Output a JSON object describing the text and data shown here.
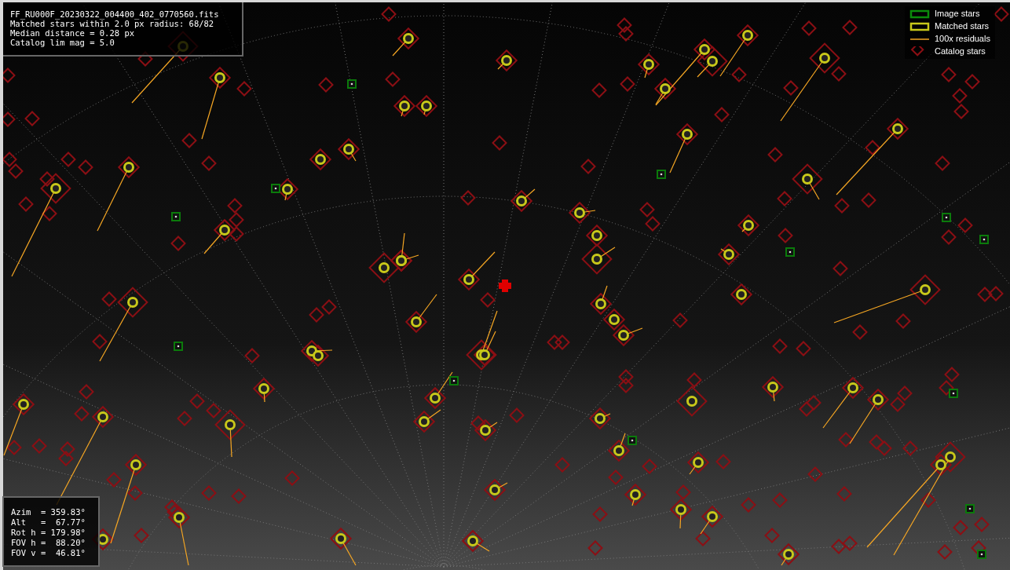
{
  "info_box": {
    "lines": [
      "FF_RU000F_20230322_004400_402_0770560.fits",
      "Matched stars within 2.0 px radius: 68/82",
      "Median distance = 0.28 px",
      "Catalog lim mag = 5.0"
    ]
  },
  "legend": [
    {
      "kind": "image",
      "label": "Image stars"
    },
    {
      "kind": "matched",
      "label": "Matched stars"
    },
    {
      "kind": "residual",
      "label": "100x residuals"
    },
    {
      "kind": "catalog",
      "label": "Catalog stars"
    }
  ],
  "pointing_box": {
    "lines": [
      "Azim  = 359.83°",
      "Alt   =  67.77°",
      "Rot h = 179.98°",
      "FOV h =  88.20°",
      "FOV v =  46.81°"
    ]
  }
}
